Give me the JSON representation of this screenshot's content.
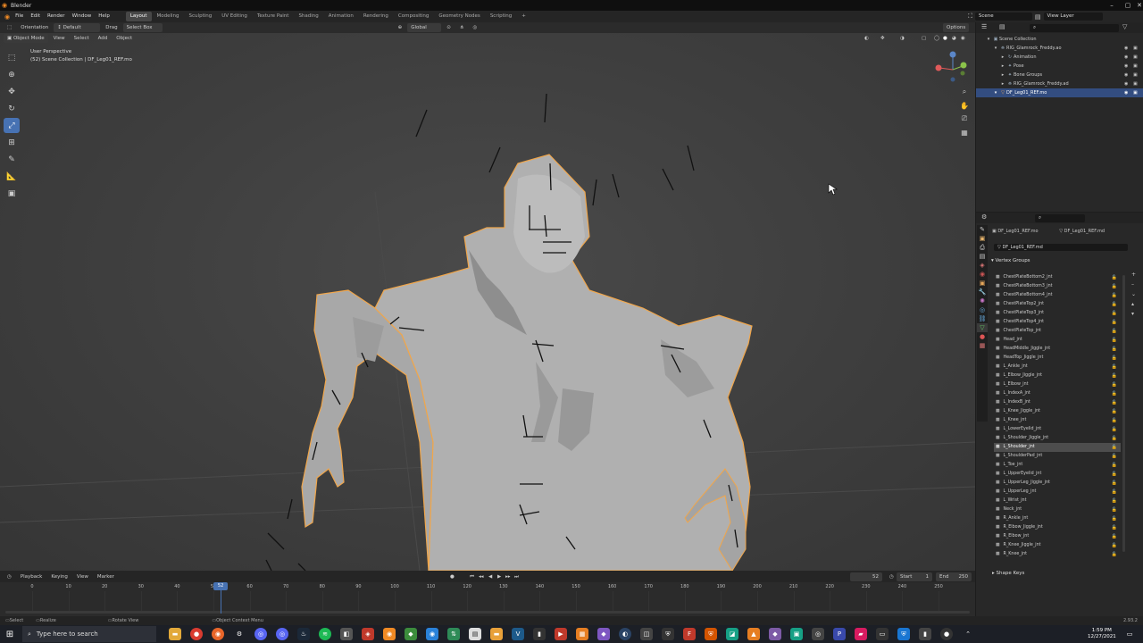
{
  "window": {
    "title": "Blender"
  },
  "menu": [
    "File",
    "Edit",
    "Render",
    "Window",
    "Help"
  ],
  "workspaces": [
    {
      "label": "Layout",
      "active": true
    },
    {
      "label": "Modeling"
    },
    {
      "label": "Sculpting"
    },
    {
      "label": "UV Editing"
    },
    {
      "label": "Texture Paint"
    },
    {
      "label": "Shading"
    },
    {
      "label": "Animation"
    },
    {
      "label": "Rendering"
    },
    {
      "label": "Compositing"
    },
    {
      "label": "Geometry Nodes"
    },
    {
      "label": "Scripting"
    }
  ],
  "topright": {
    "scene": "Scene",
    "view_layer": "View Layer"
  },
  "viewport_header": {
    "orientation_label": "Orientation",
    "orientation_value": "Default",
    "drag_label": "Drag",
    "drag_value": "Select Box",
    "transform_label": "Global",
    "options_label": "Options"
  },
  "viewport_header2": {
    "mode": "Object Mode",
    "items": [
      "View",
      "Select",
      "Add",
      "Object"
    ]
  },
  "viewport_overlay": {
    "line1": "User Perspective",
    "line2": "(52) Scene Collection | DF_Leg01_REF.mo"
  },
  "outliner": {
    "rows": [
      {
        "label": "Scene Collection",
        "indent": 0,
        "icon": "▣"
      },
      {
        "label": "RIG_Glamrock_Freddy.ao",
        "indent": 1,
        "icon": "⛯"
      },
      {
        "label": "Animation",
        "indent": 2,
        "icon": "↻"
      },
      {
        "label": "Pose",
        "indent": 2,
        "icon": "✦"
      },
      {
        "label": "Bone Groups",
        "indent": 2,
        "icon": "✦"
      },
      {
        "label": "RIG_Glamrock_Freddy.ad",
        "indent": 2,
        "icon": "⛯"
      },
      {
        "label": "DF_Leg01_REF.mo",
        "indent": 1,
        "icon": "▽",
        "selected": true
      }
    ]
  },
  "properties": {
    "breadcrumb_object": "DF_Leg01_REF.mo",
    "breadcrumb_mesh": "DF_Leg01_REF.md",
    "mesh_name": "DF_Leg01_REF.md",
    "vertex_groups_title": "Vertex Groups",
    "shape_keys_title": "Shape Keys",
    "vertex_groups": [
      "ChestPlateBottom2_jnt",
      "ChestPlateBottom3_jnt",
      "ChestPlateBottom4_jnt",
      "ChestPlateTop2_jnt",
      "ChestPlateTop3_jnt",
      "ChestPlateTop4_jnt",
      "ChestPlateTop_jnt",
      "Head_jnt",
      "HeadMiddle_Jiggle_jnt",
      "HeadTop_Jiggle_jnt",
      "L_Ankle_jnt",
      "L_Elbow_Jiggle_jnt",
      "L_Elbow_jnt",
      "L_IndexA_jnt",
      "L_IndexB_jnt",
      "L_Knee_Jiggle_jnt",
      "L_Knee_jnt",
      "L_LowerEyelid_jnt",
      "L_Shoulder_Jiggle_jnt",
      "L_Shoulder_jnt",
      "L_ShoulderPad_jnt",
      "L_Toe_jnt",
      "L_UpperEyelid_jnt",
      "L_UpperLeg_Jiggle_jnt",
      "L_UpperLeg_jnt",
      "L_Wrist_jnt",
      "Neck_jnt",
      "R_Ankle_jnt",
      "R_Elbow_Jiggle_jnt",
      "R_Elbow_jnt",
      "R_Knee_Jiggle_jnt",
      "R_Knee_jnt"
    ],
    "selected_index": 19
  },
  "timeline": {
    "menu": [
      "Playback",
      "Keying",
      "View",
      "Marker"
    ],
    "current_frame": "52",
    "start_label": "Start",
    "start": "1",
    "end_label": "End",
    "end": "250",
    "ticks": [
      "0",
      "10",
      "20",
      "30",
      "40",
      "50",
      "60",
      "70",
      "80",
      "90",
      "100",
      "110",
      "120",
      "130",
      "140",
      "150",
      "160",
      "170",
      "180",
      "190",
      "200",
      "210",
      "220",
      "230",
      "240",
      "250"
    ]
  },
  "statusbar": {
    "select": "Select",
    "realize": "Realize",
    "rotate": "Rotate View",
    "context": "Object Context Menu",
    "version": "2.93.2"
  },
  "taskbar": {
    "search_placeholder": "Type here to search",
    "time": "1:59 PM",
    "date": "12/27/2021"
  },
  "colors": {
    "accent": "#4772b3",
    "selection_outline": "#f0a64b",
    "bone": "#111111"
  }
}
